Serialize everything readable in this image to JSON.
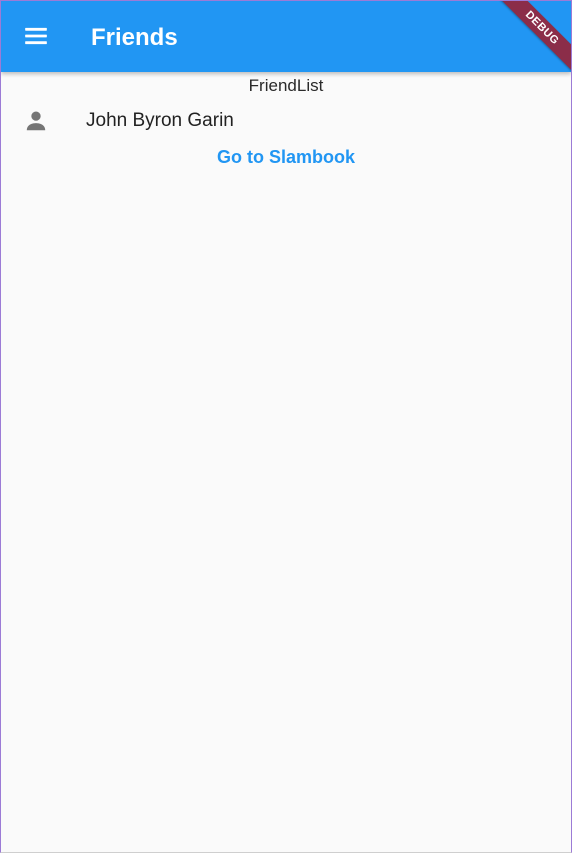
{
  "appbar": {
    "title": "Friends",
    "menu_icon": "menu-icon",
    "color": "#2196f3"
  },
  "debug_banner": {
    "label": "DEBUG",
    "color": "#8b2d49"
  },
  "friend_list": {
    "header": "FriendList",
    "items": [
      {
        "icon": "person-icon",
        "name": "John Byron Garin"
      }
    ]
  },
  "actions": {
    "go_to_slambook_label": "Go to Slambook"
  }
}
